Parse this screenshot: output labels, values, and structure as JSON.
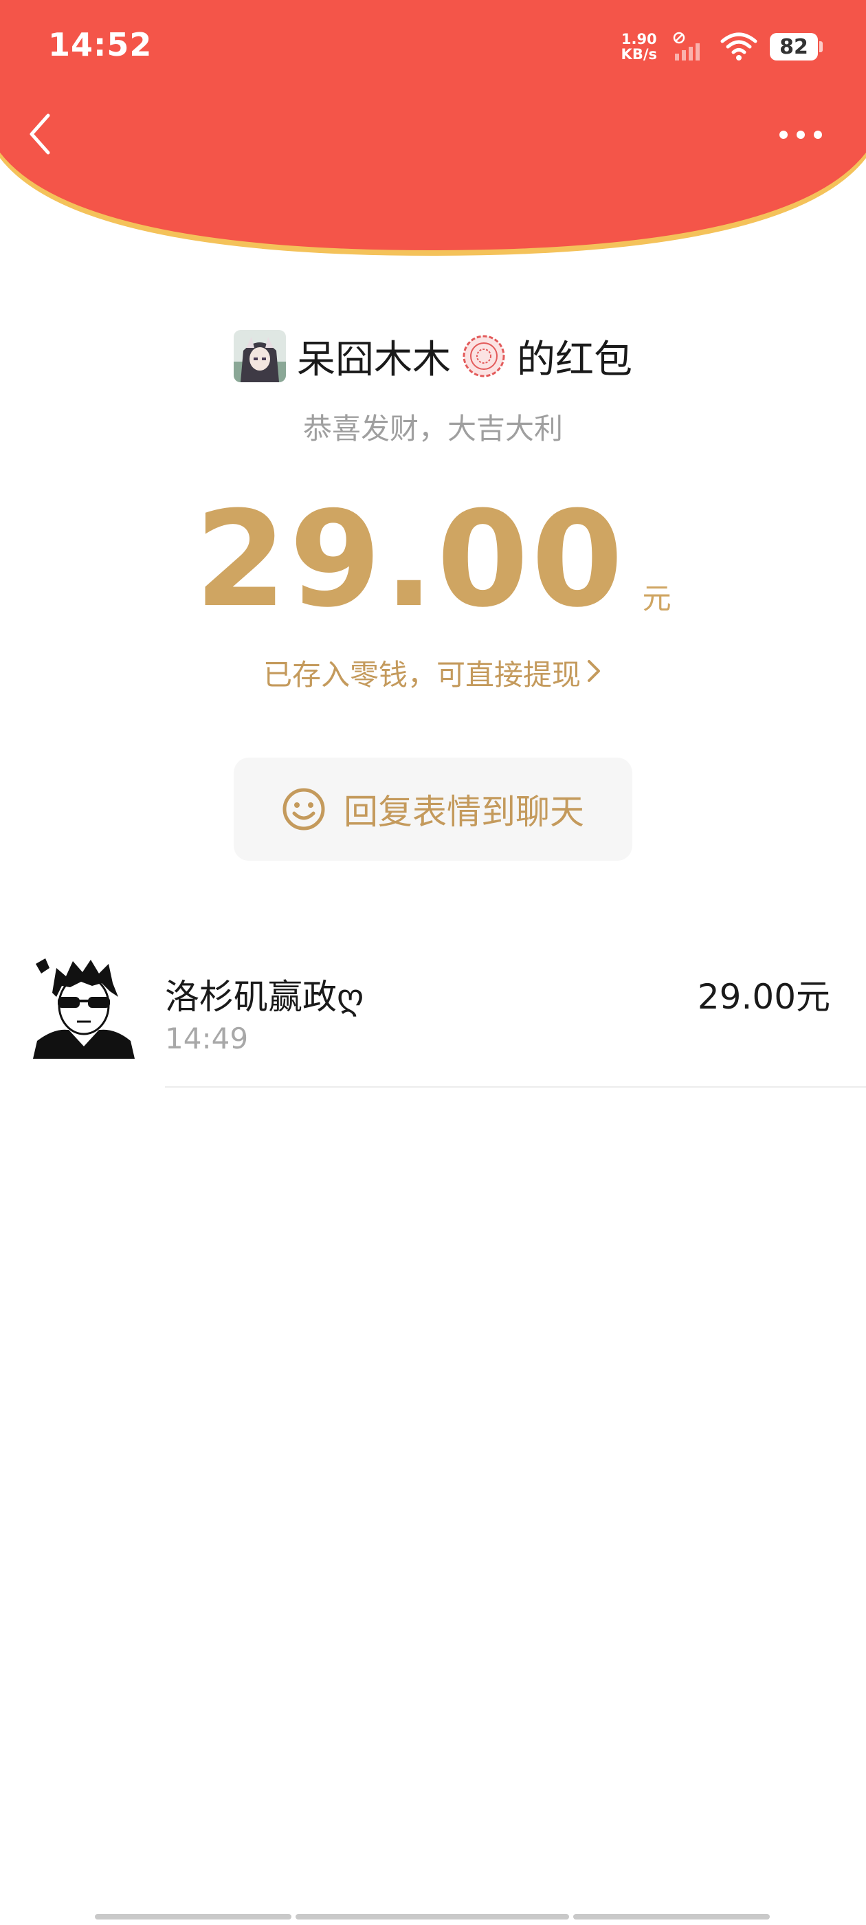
{
  "status_bar": {
    "time": "14:52",
    "net_speed_value": "1.90",
    "net_speed_unit": "KB/s",
    "battery": "82"
  },
  "colors": {
    "header_red": "#F45549",
    "gold": "#CFA562",
    "rim": "#F4C25A"
  },
  "nav": {
    "back_icon": "chevron-left-icon",
    "more_icon": "ellipsis-icon"
  },
  "envelope": {
    "sender_name": "呆囧木木",
    "title_suffix": "的红包",
    "greeting": "恭喜发财，大吉大利",
    "amount": "29.00",
    "amount_unit": "元",
    "deposit_text": "已存入零钱，可直接提现",
    "reply_label": "回复表情到聊天"
  },
  "receivers": [
    {
      "name": "洛杉矶赢政ღ",
      "time": "14:49",
      "amount": "29.00元"
    }
  ]
}
